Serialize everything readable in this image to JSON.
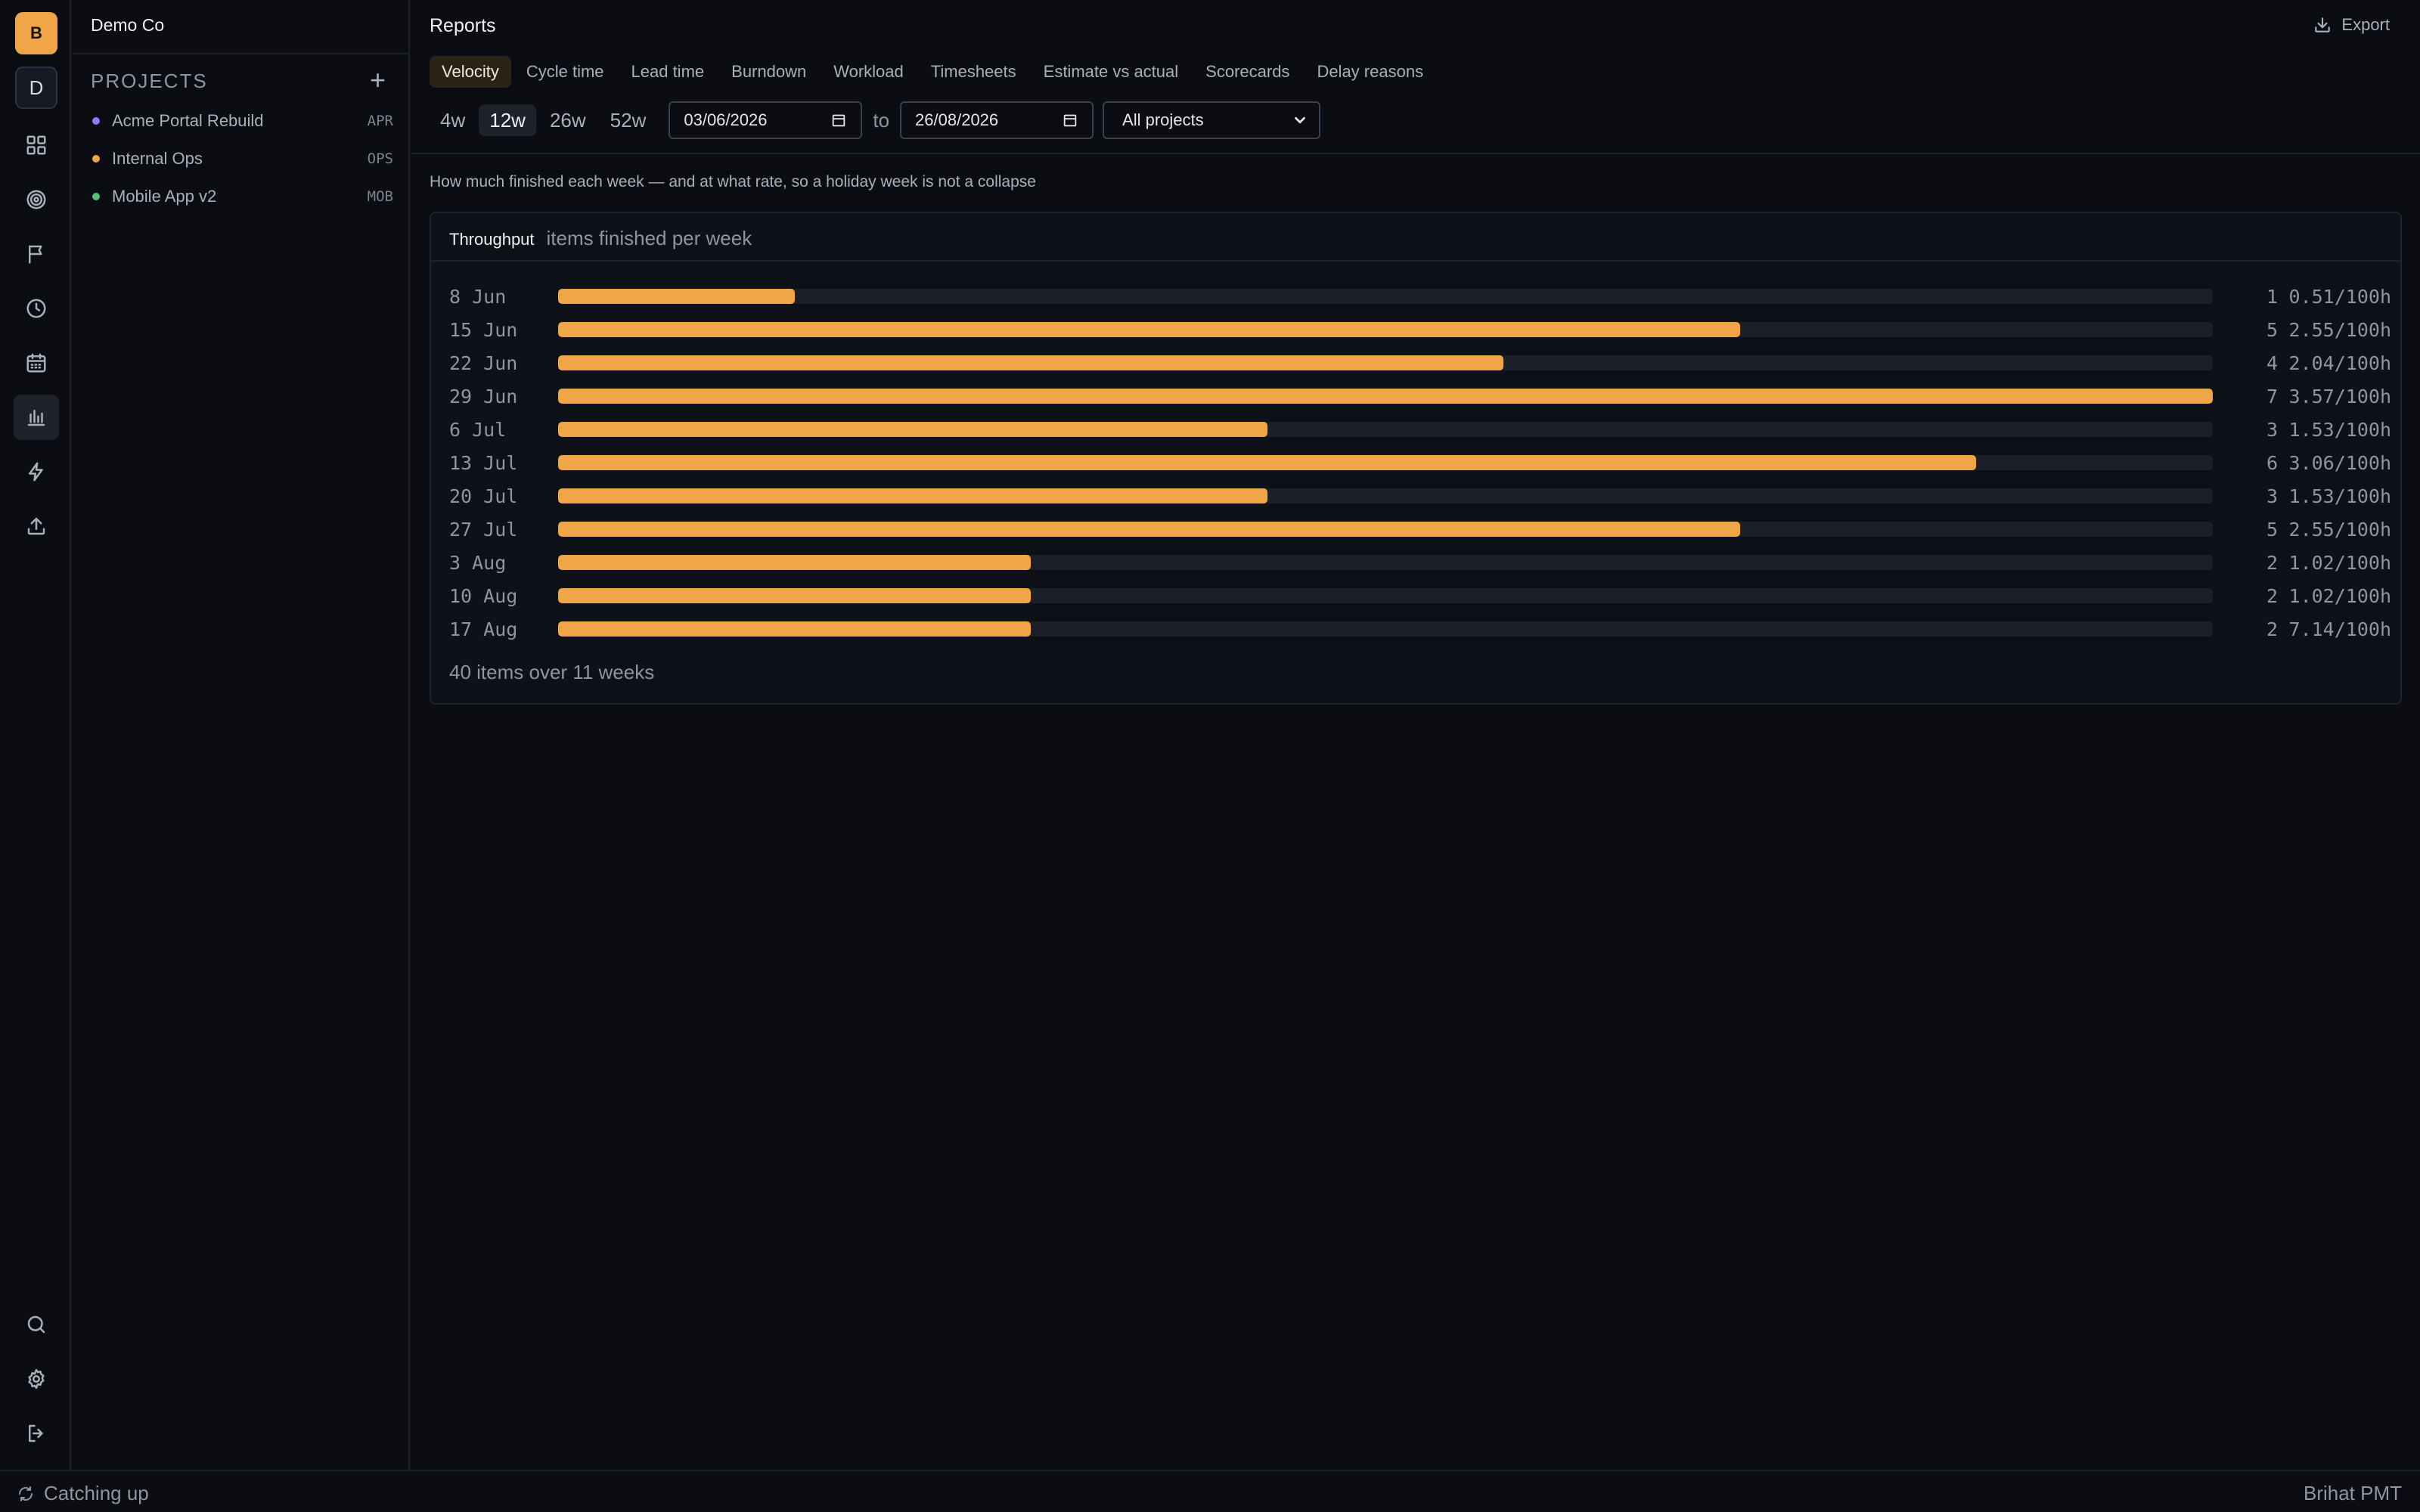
{
  "workspace": {
    "badge": "B",
    "switcher": "D"
  },
  "rail": {
    "icons": [
      "dashboard-icon",
      "goals-icon",
      "flag-icon",
      "clock-icon",
      "calendar-icon",
      "bar-chart-icon",
      "lightning-icon",
      "upload-icon",
      "search-icon",
      "gear-icon",
      "logout-icon"
    ],
    "active": "bar-chart-icon"
  },
  "sidebar": {
    "org_name": "Demo Co",
    "projects_heading": "PROJECTS",
    "add_label": "+",
    "projects": [
      {
        "name": "Acme Portal Rebuild",
        "code": "APR",
        "color": "#8b7cf6"
      },
      {
        "name": "Internal Ops",
        "code": "OPS",
        "color": "#f0a646"
      },
      {
        "name": "Mobile App v2",
        "code": "MOB",
        "color": "#4ec27a"
      }
    ]
  },
  "header": {
    "title": "Reports",
    "export_label": "Export"
  },
  "tabs": [
    {
      "label": "Velocity",
      "active": true
    },
    {
      "label": "Cycle time",
      "active": false
    },
    {
      "label": "Lead time",
      "active": false
    },
    {
      "label": "Burndown",
      "active": false
    },
    {
      "label": "Workload",
      "active": false
    },
    {
      "label": "Timesheets",
      "active": false
    },
    {
      "label": "Estimate vs actual",
      "active": false
    },
    {
      "label": "Scorecards",
      "active": false
    },
    {
      "label": "Delay reasons",
      "active": false
    }
  ],
  "filters": {
    "ranges": [
      {
        "label": "4w",
        "active": false
      },
      {
        "label": "12w",
        "active": true
      },
      {
        "label": "26w",
        "active": false
      },
      {
        "label": "52w",
        "active": false
      }
    ],
    "from_date": "03/06/2026",
    "to_label": "to",
    "to_date": "26/08/2026",
    "project_select": "All projects"
  },
  "caption": "How much finished each week — and at what rate, so a holiday week is not a collapse",
  "card": {
    "title": "Throughput",
    "subtitle": "items finished per week",
    "footer": "40 items over 11 weeks"
  },
  "chart_data": {
    "type": "bar",
    "orientation": "horizontal",
    "title": "Throughput",
    "subtitle": "items finished per week",
    "categories": [
      "8 Jun",
      "15 Jun",
      "22 Jun",
      "29 Jun",
      "6 Jul",
      "13 Jul",
      "20 Jul",
      "27 Jul",
      "3 Aug",
      "10 Aug",
      "17 Aug"
    ],
    "values": [
      1,
      5,
      4,
      7,
      3,
      6,
      3,
      5,
      2,
      2,
      2
    ],
    "rates": [
      "0.51/100h",
      "2.55/100h",
      "2.04/100h",
      "3.57/100h",
      "1.53/100h",
      "3.06/100h",
      "1.53/100h",
      "2.55/100h",
      "1.02/100h",
      "1.02/100h",
      "7.14/100h"
    ],
    "xlim": [
      0,
      7
    ],
    "bar_color": "#f0a646"
  },
  "status": {
    "sync_text": "Catching up",
    "brand": "Brihat PMT"
  }
}
